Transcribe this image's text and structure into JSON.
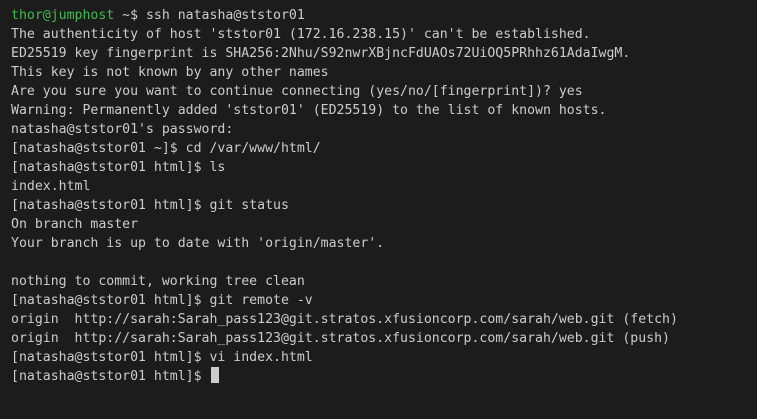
{
  "theme": {
    "background": "#1c1c1c",
    "text": "#cccccc",
    "prompt_user_color": "#3fb950"
  },
  "first_prompt": {
    "user_host": "thor@jumphost",
    "symbol": " ~$ ",
    "command": "ssh natasha@ststor01"
  },
  "lines": [
    "The authenticity of host 'ststor01 (172.16.238.15)' can't be established.",
    "ED25519 key fingerprint is SHA256:2Nhu/S92nwrXBjncFdUAOs72UiOQ5PRhhz61AdaIwgM.",
    "This key is not known by any other names",
    "Are you sure you want to continue connecting (yes/no/[fingerprint])? yes",
    "Warning: Permanently added 'ststor01' (ED25519) to the list of known hosts.",
    "natasha@ststor01's password: ",
    "[natasha@ststor01 ~]$ cd /var/www/html/",
    "[natasha@ststor01 html]$ ls",
    "index.html",
    "[natasha@ststor01 html]$ git status",
    "On branch master",
    "Your branch is up to date with 'origin/master'.",
    "",
    "nothing to commit, working tree clean",
    "[natasha@ststor01 html]$ git remote -v",
    "origin  http://sarah:Sarah_pass123@git.stratos.xfusioncorp.com/sarah/web.git (fetch)",
    "origin  http://sarah:Sarah_pass123@git.stratos.xfusioncorp.com/sarah/web.git (push)",
    "[natasha@ststor01 html]$ vi index.html"
  ],
  "last_prompt": "[natasha@ststor01 html]$ "
}
